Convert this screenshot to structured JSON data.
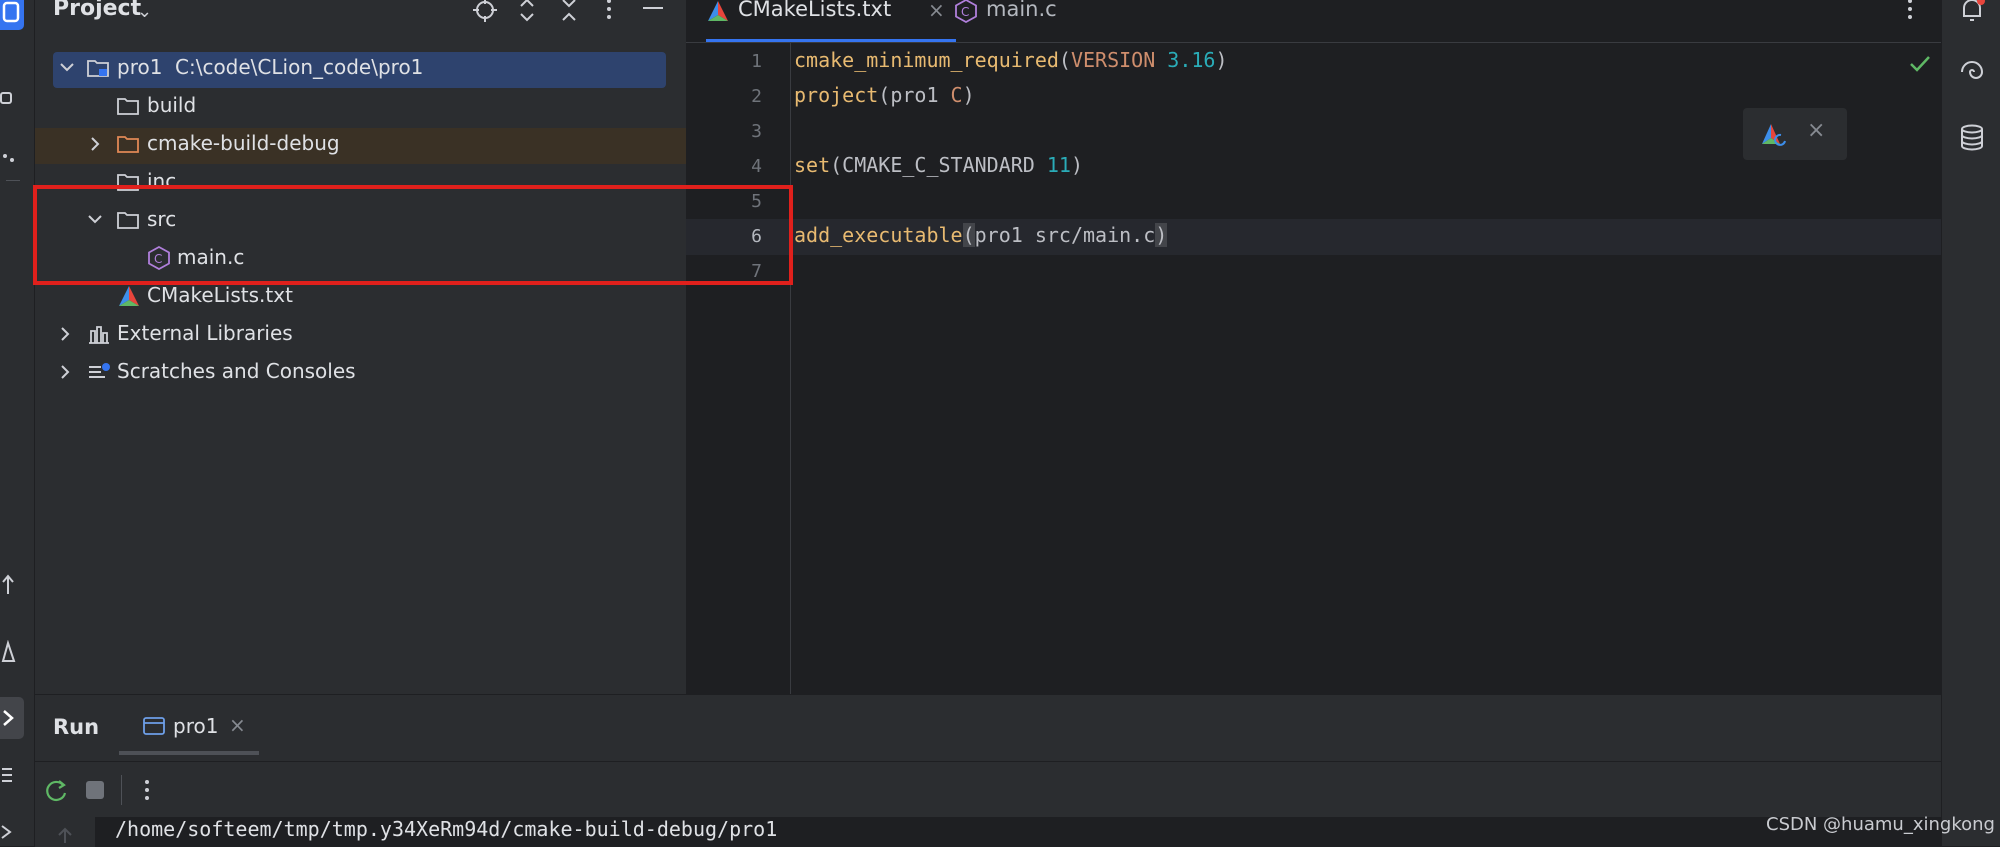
{
  "project_panel": {
    "title": "Project",
    "tree": [
      {
        "name": "pro1",
        "path": "C:\\code\\CLion_code\\pro1"
      },
      {
        "name": "build"
      },
      {
        "name": "cmake-build-debug"
      },
      {
        "name": "inc"
      },
      {
        "name": "src"
      },
      {
        "name": "main.c"
      },
      {
        "name": "CMakeLists.txt"
      },
      {
        "name": "External Libraries"
      },
      {
        "name": "Scratches and Consoles"
      }
    ]
  },
  "editor": {
    "tabs": [
      {
        "label": "CMakeLists.txt"
      },
      {
        "label": "main.c"
      }
    ],
    "line_numbers": [
      "1",
      "2",
      "3",
      "4",
      "5",
      "6",
      "7"
    ],
    "lines": [
      [
        "cmake_minimum_required",
        "(",
        "VERSION",
        " ",
        "3.16",
        ")"
      ],
      [
        "project",
        "(pro1 ",
        "C",
        ")"
      ],
      [],
      [
        "set",
        "(CMAKE_C_STANDARD ",
        "11",
        ")"
      ],
      [],
      [
        "add_executable",
        "(",
        "pro1 src/main.c",
        ")"
      ],
      []
    ]
  },
  "run_panel": {
    "title": "Run",
    "tab_label": "pro1",
    "console_line": "/home/softeem/tmp/tmp.y34XeRm94d/cmake-build-debug/pro1"
  },
  "watermark": "CSDN @huamu_xingkong",
  "colors": {
    "panel_bg": "#2b2d30",
    "editor_bg": "#1e1f22",
    "selection": "#2e436e",
    "highlight_box": "#e0201c",
    "keyword": "#e8ba71",
    "number": "#2aacb8",
    "check": "#5fb865"
  }
}
